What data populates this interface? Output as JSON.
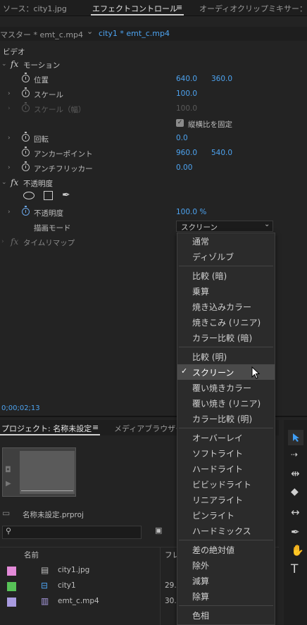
{
  "top_tabs": {
    "source": "ソース：city1.jpg",
    "effect_controls": "エフェクトコントロール",
    "menu_glyph": "≡",
    "audio_mixer": "オーディオクリップミキサー：ci"
  },
  "sequence": {
    "master": "マスター * emt_c.mp4",
    "chevron": "⌄",
    "clip": "city1 * emt_c.mp4"
  },
  "video_label": "ビデオ",
  "motion": {
    "label": "モーション",
    "fx": "fx",
    "position_label": "位置",
    "position_x": "640.0",
    "position_y": "360.0",
    "scale_label": "スケール",
    "scale_value": "100.0",
    "scale_width_label": "スケール（幅）",
    "scale_width_value": "100.0",
    "uniform_scale_label": "縦横比を固定",
    "rotation_label": "回転",
    "rotation_value": "0.0",
    "anchor_label": "アンカーポイント",
    "anchor_x": "960.0",
    "anchor_y": "540.0",
    "flicker_label": "アンチフリッカー",
    "flicker_value": "0.00"
  },
  "opacity": {
    "label": "不透明度",
    "fx": "fx",
    "opacity_label": "不透明度",
    "opacity_value": "100.0 %",
    "blend_label": "描画モード",
    "blend_value": "スクリーン"
  },
  "time_remap": {
    "label": "タイムリマップ",
    "fx": "fx"
  },
  "timecode": "0;00;02;13",
  "blend_menu": {
    "groups": [
      [
        "通常",
        "ディゾルブ"
      ],
      [
        "比較 (暗)",
        "乗算",
        "焼き込みカラー",
        "焼きこみ (リニア)",
        "カラー比較 (暗)"
      ],
      [
        "比較 (明)",
        "スクリーン",
        "覆い焼きカラー",
        "覆い焼き (リニア)",
        "カラー比較 (明)"
      ],
      [
        "オーバーレイ",
        "ソフトライト",
        "ハードライト",
        "ビビッドライト",
        "リニアライト",
        "ピンライト",
        "ハードミックス"
      ],
      [
        "差の絶対値",
        "除外",
        "減算",
        "除算"
      ],
      [
        "色相"
      ]
    ],
    "selected": "スクリーン",
    "check": "✓"
  },
  "project": {
    "tab_label": "プロジェクト: 名称未設定",
    "menu_glyph": "≡",
    "media_browser": "メディアブラウザー",
    "file_name": "名称未設定.prproj",
    "search_placeholder": "",
    "col_name": "名前",
    "col_fr": "フレ",
    "items": [
      {
        "name": "city1.jpg",
        "fr": "",
        "color": "#e38ad8"
      },
      {
        "name": "city1",
        "fr": "29.",
        "color": "#57c257"
      },
      {
        "name": "emt_c.mp4",
        "fr": "30.",
        "color": "#a99be0"
      }
    ]
  },
  "colors": {
    "accent_blue": "#4da3f0",
    "selection_tool": "#3f9ef5"
  },
  "tool_icons": [
    "selection-tool-icon",
    "track-select-icon",
    "ripple-edit-icon",
    "razor-icon",
    "slip-icon",
    "pen-icon",
    "hand-icon",
    "type-icon"
  ],
  "tool_glyphs": {
    "ripple": "⇹",
    "slip": "↔",
    "pen": "✒",
    "hand": "✋",
    "type": "T"
  }
}
